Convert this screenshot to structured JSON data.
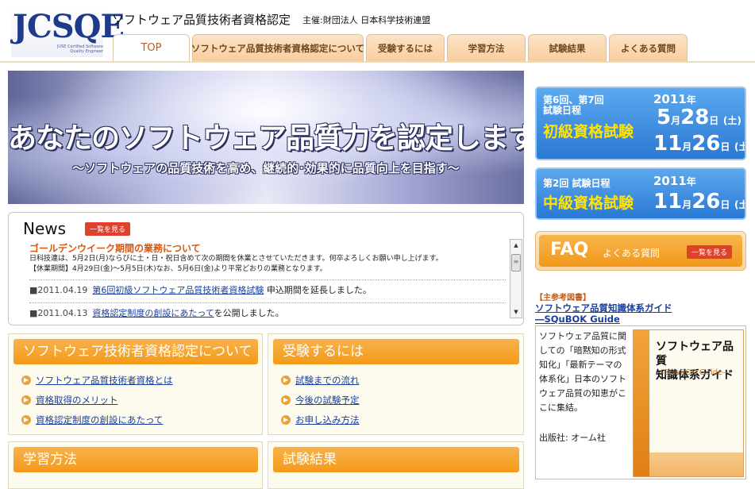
{
  "header": {
    "logo_text": "JCSQE",
    "logo_sub": "JUSE Certified Software Quality Engineer",
    "title": "ソフトウェア品質技術者資格認定",
    "sponsor": "主催:財団法人 日本科学技術連盟"
  },
  "tabs": [
    {
      "label": "TOP",
      "active": true
    },
    {
      "label": "ソフトウェア品質技術者資格認定について",
      "active": false
    },
    {
      "label": "受験するには",
      "active": false
    },
    {
      "label": "学習方法",
      "active": false
    },
    {
      "label": "試験結果",
      "active": false
    },
    {
      "label": "よくある質問",
      "active": false
    }
  ],
  "hero": {
    "title": "あなたのソフトウェア品質力を認定します!!",
    "subtitle": "～ソフトウェアの品質技術を高め、継続的･効果的に品質向上を目指す～"
  },
  "news": {
    "title": "News",
    "view_all": "一覧を見る",
    "featured": {
      "headline": "ゴールデンウイーク期間の業務について",
      "body1": "日科技連は、5月2日(月)ならびに土・日・祝日含めて次の期間を休業とさせていただきます。何卒よろしくお願い申し上げます。",
      "body2": "【休業期間】4月29日(金)～5月5日(木)なお、5月6日(金)より平常どおりの業務となります。"
    },
    "items": [
      {
        "date": "■2011.04.19",
        "link": "第6回初級ソフトウェア品質技術者資格試験",
        "text": "申込期間を延長しました。"
      },
      {
        "date": "■2011.04.13",
        "link": "資格認定制度の創設にあたって",
        "text": "を公開しました。"
      }
    ]
  },
  "box_about": {
    "title": "ソフトウェア技術者資格認定について",
    "links": [
      "ソフトウェア品質技術者資格とは",
      "資格取得のメリット",
      "資格認定制度の創設にあたって"
    ]
  },
  "box_exam": {
    "title": "受験するには",
    "links": [
      "試験までの流れ",
      "今後の試験予定",
      "お申し込み方法"
    ]
  },
  "box_study": {
    "title": "学習方法"
  },
  "box_results": {
    "title": "試験結果"
  },
  "exam_basic": {
    "line1": "第6回、第7回",
    "line2": "試験日程",
    "level": "初級資格試験",
    "year": "2011",
    "nen": "年",
    "d1_month": "5",
    "d1_day": "28",
    "d1_dow": "(土)",
    "d2_month": "11",
    "d2_day": "26",
    "d2_dow": "(土)",
    "tsuki": "月",
    "nichi": "日"
  },
  "exam_mid": {
    "line1": "第2回 試験日程",
    "level": "中級資格試験",
    "year": "2011",
    "nen": "年",
    "d_month": "11",
    "d_day": "26",
    "d_dow": "(土)",
    "tsuki": "月",
    "nichi": "日"
  },
  "faq": {
    "title": "FAQ",
    "subtitle": "よくある質問",
    "button": "一覧を見る"
  },
  "book": {
    "label": "【主参考図書】",
    "title1": "ソフトウェア品質知識体系ガイド",
    "title2": "―SQuBOK Guide",
    "description": "ソフトウェア品質に関しての「暗黙知の形式知化」「最新テーマの体系化」日本のソフトウェア品質の知恵がここに集結。",
    "publisher": "出版社: オーム社",
    "cover_title1": "ソフトウェア品質",
    "cover_title2": "知識体系ガイド",
    "cover_sub": "―SQuBOK Guide―"
  },
  "colors": {
    "brand_blue": "#1e3a8a",
    "tab_orange": "#f7cf9f",
    "box_orange": "#f39a1a",
    "exam_blue": "#2b78d3",
    "highlight_yellow": "#ffe400",
    "news_orange": "#d9560f",
    "button_red": "#e0412d"
  }
}
